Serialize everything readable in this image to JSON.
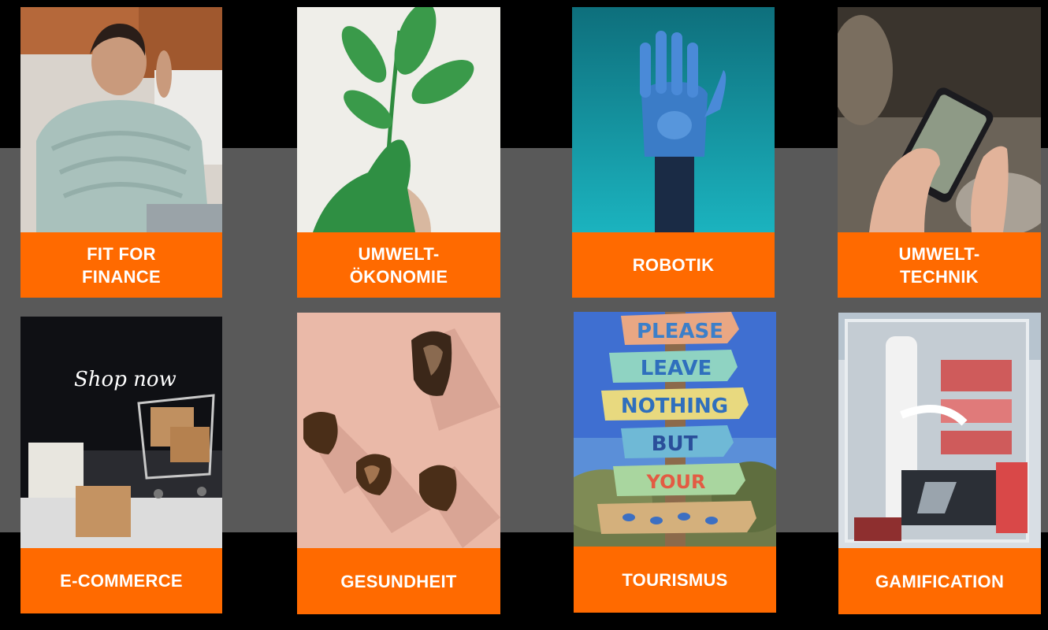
{
  "colors": {
    "band": "#595959",
    "background": "#000000",
    "label_bg": "#ff6a00",
    "label_text": "#ffffff"
  },
  "tiles": [
    {
      "id": "fit-for-finance",
      "lines": [
        "FIT FOR",
        "FINANCE"
      ],
      "image": "woman-in-sweater-photo"
    },
    {
      "id": "umwelt-oekonomie",
      "lines": [
        "UMWELT-",
        "ÖKONOMIE"
      ],
      "image": "green-painted-hand-with-plant-photo"
    },
    {
      "id": "robotik",
      "lines": [
        "ROBOTIK"
      ],
      "image": "robotic-hand-photo"
    },
    {
      "id": "umwelt-technik",
      "lines": [
        "UMWELT-",
        "TECHNIK"
      ],
      "image": "hands-with-smartphone-photo"
    },
    {
      "id": "e-commerce",
      "lines": [
        "E-COMMERCE"
      ],
      "image": "shopping-cart-with-boxes-photo",
      "image_text": "Shop now"
    },
    {
      "id": "gesundheit",
      "lines": [
        "GESUNDHEIT"
      ],
      "image": "amber-crystals-photo"
    },
    {
      "id": "tourismus",
      "lines": [
        "TOURISMUS"
      ],
      "image": "wooden-signpost-photo",
      "image_text": [
        "PLEASE",
        "LEAVE",
        "NOTHING",
        "BUT",
        "YOUR"
      ]
    },
    {
      "id": "gamification",
      "lines": [
        "GAMIFICATION"
      ],
      "image": "gaming-pc-interior-photo"
    }
  ]
}
